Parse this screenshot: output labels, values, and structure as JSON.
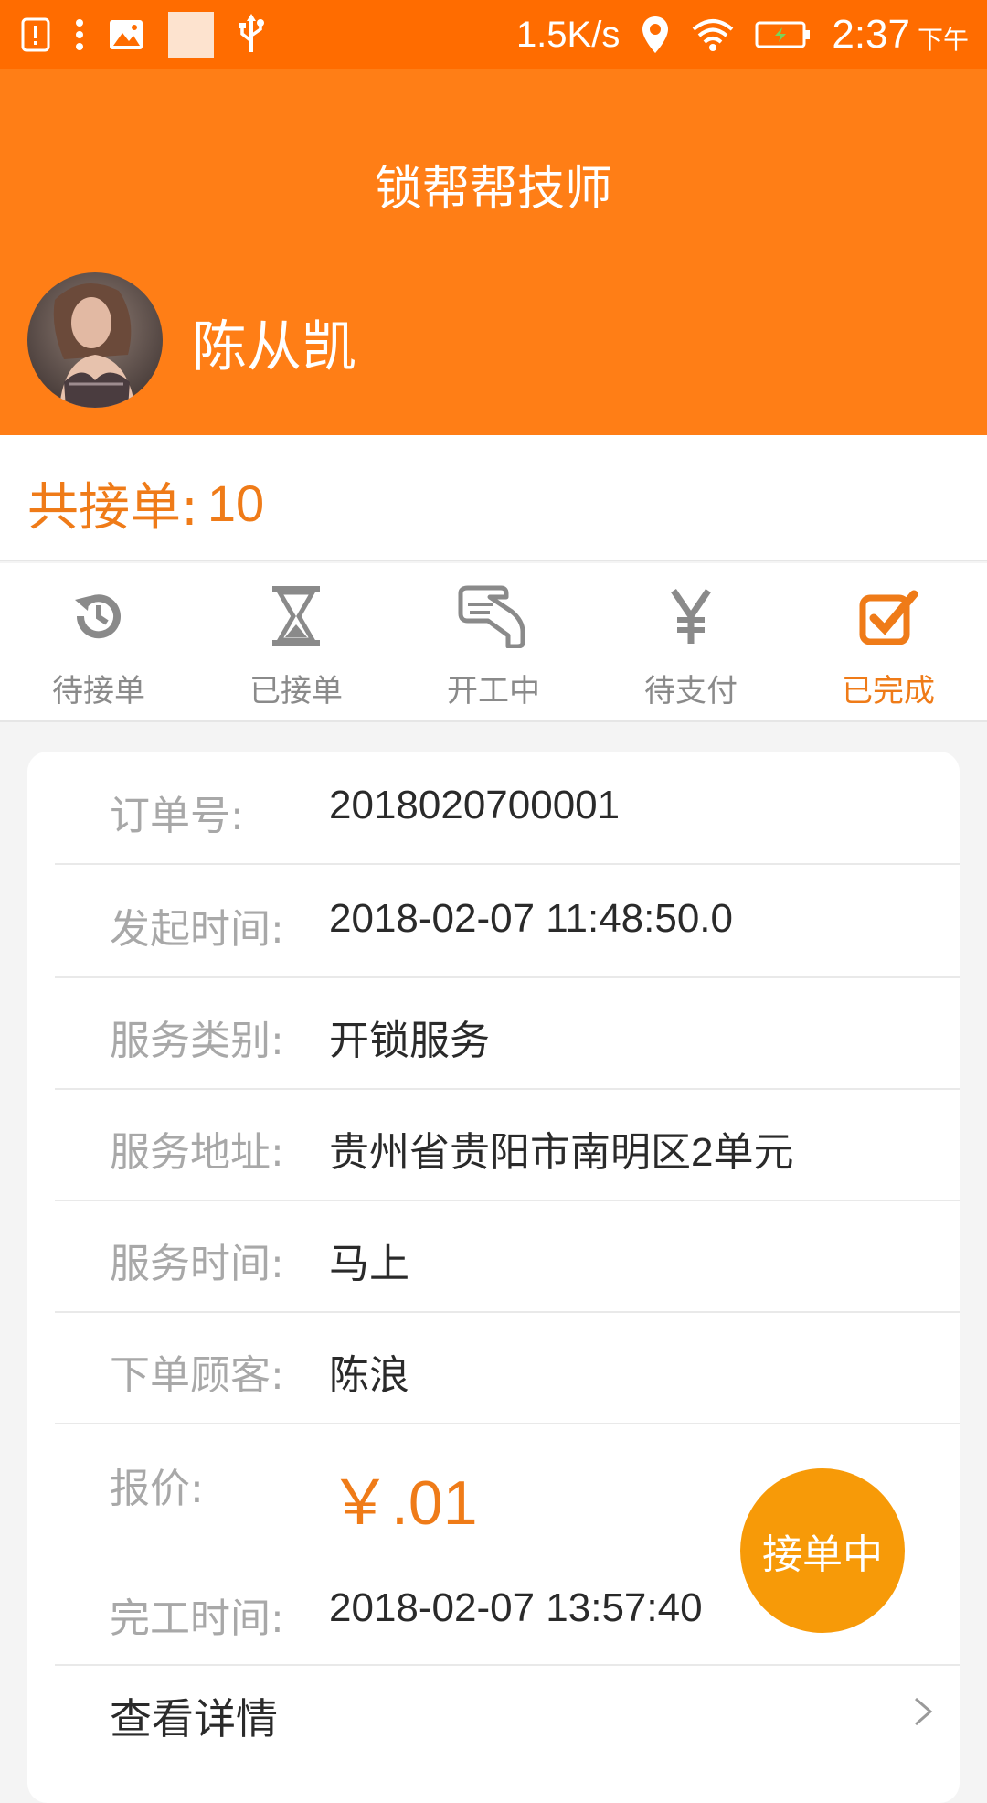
{
  "status_bar": {
    "net_speed": "1.5K/s",
    "time": "2:37",
    "ampm": "下午",
    "icons": [
      "alert-icon",
      "more-vert-icon",
      "image-icon",
      "usb-icon",
      "location-icon",
      "wifi-icon",
      "battery-icon"
    ]
  },
  "header": {
    "title": "锁帮帮技师",
    "user_name": "陈从凯"
  },
  "summary": {
    "label": "共接单:",
    "count": "10"
  },
  "tabs": [
    {
      "label": "待接单",
      "icon": "history-icon"
    },
    {
      "label": "已接单",
      "icon": "hourglass-icon"
    },
    {
      "label": "开工中",
      "icon": "hand-icon"
    },
    {
      "label": "待支付",
      "icon": "yen-icon"
    },
    {
      "label": "已完成",
      "icon": "checkbox-icon",
      "active": true
    }
  ],
  "order": {
    "order_no_label": "订单号:",
    "order_no": "2018020700001",
    "start_time_label": "发起时间:",
    "start_time": "2018-02-07 11:48:50.0",
    "category_label": "服务类别:",
    "category": "开锁服务",
    "address_label": "服务地址:",
    "address": "贵州省贵阳市南明区2单元",
    "service_time_label": "服务时间:",
    "service_time": "马上",
    "customer_label": "下单顾客:",
    "customer": "陈浪",
    "price_label": "报价:",
    "price": "￥.01",
    "finish_time_label": "完工时间:",
    "finish_time": "2018-02-07 13:57:40",
    "accept_button": "接单中",
    "detail_label": "查看详情"
  },
  "colors": {
    "status_bar": "#ff6c00",
    "header": "#ff7e16",
    "accent": "#ef7b18",
    "button": "#f79a08"
  }
}
